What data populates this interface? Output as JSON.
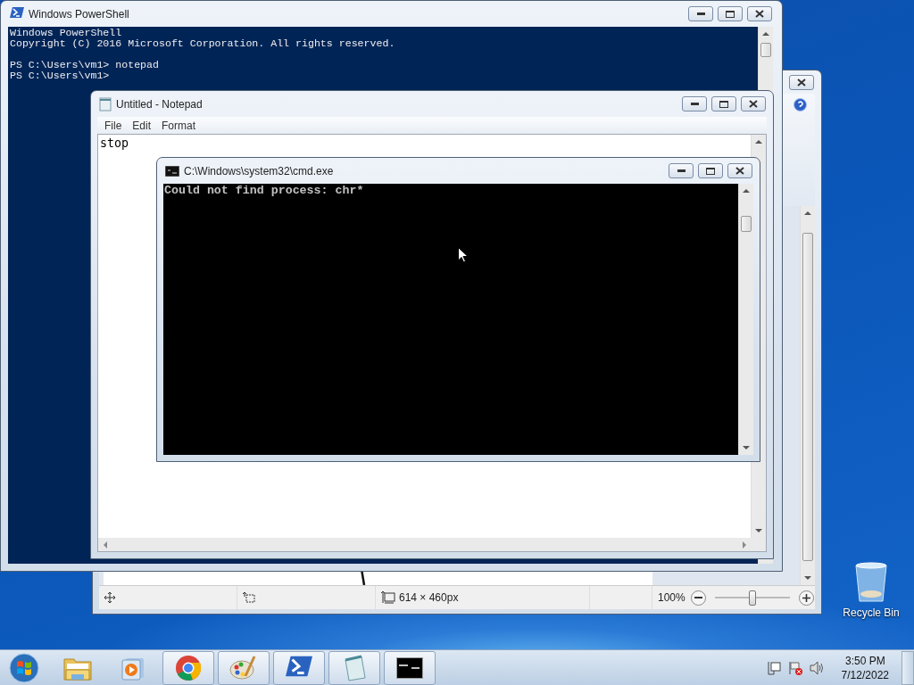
{
  "windows": [
    {
      "kind": "paint",
      "status_bar": {
        "image_size": "614 × 460px",
        "zoom": "100%"
      },
      "zoom_slider": {
        "level": 0.5
      }
    },
    {
      "kind": "powershell",
      "title": "Windows PowerShell",
      "blocks": [
        [
          "Windows PowerShell",
          "Copyright (C) 2016 Microsoft Corporation. All rights reserved."
        ],
        [
          "PS C:\\Users\\vm1> notepad",
          "PS C:\\Users\\vm1>"
        ]
      ]
    },
    {
      "kind": "notepad",
      "title": "Untitled - Notepad",
      "menu": [
        "File",
        "Edit",
        "Format"
      ],
      "text": "stop"
    },
    {
      "kind": "cmd",
      "title": "C:\\Windows\\system32\\cmd.exe",
      "lines": [
        "Could not find process: chr*"
      ]
    }
  ],
  "desktop_icons": [
    {
      "label": "Recycle Bin"
    }
  ],
  "taskbar": {
    "apps": [
      {
        "kind": "explorer",
        "running": false
      },
      {
        "kind": "media",
        "running": false
      },
      {
        "kind": "chrome",
        "running": true
      },
      {
        "kind": "paint",
        "running": true
      },
      {
        "kind": "powershell",
        "running": true
      },
      {
        "kind": "notepad",
        "running": true
      },
      {
        "kind": "cmd",
        "running": true
      }
    ],
    "clock": {
      "time": "3:50 PM",
      "date": "7/12/2022"
    }
  }
}
